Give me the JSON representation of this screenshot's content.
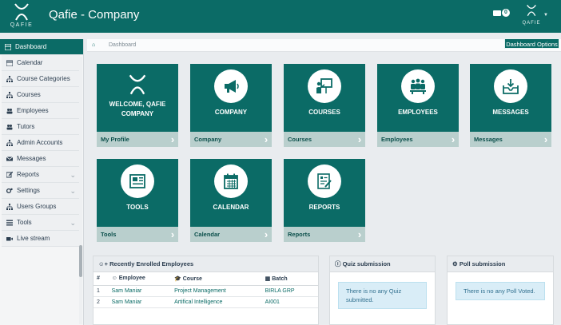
{
  "header": {
    "logo_text": "QAFIE",
    "title": "Qafie - Company",
    "mail_count": "0",
    "user_logo_text": "QAFIE"
  },
  "sidebar": {
    "items": [
      {
        "label": "Dashboard",
        "icon": "dashboard-icon",
        "active": true
      },
      {
        "label": "Calendar",
        "icon": "calendar-icon"
      },
      {
        "label": "Course Categories",
        "icon": "sitemap-icon"
      },
      {
        "label": "Courses",
        "icon": "sitemap-icon"
      },
      {
        "label": "Employees",
        "icon": "users-icon"
      },
      {
        "label": "Tutors",
        "icon": "users-icon"
      },
      {
        "label": "Admin Accounts",
        "icon": "sitemap-icon"
      },
      {
        "label": "Messages",
        "icon": "envelope-icon"
      },
      {
        "label": "Reports",
        "icon": "edit-icon",
        "expandable": true
      },
      {
        "label": "Settings",
        "icon": "cogs-icon",
        "expandable": true
      },
      {
        "label": "Users Groups",
        "icon": "sitemap-icon"
      },
      {
        "label": "Tools",
        "icon": "list-icon",
        "expandable": true
      },
      {
        "label": "Live stream",
        "icon": "video-icon"
      }
    ]
  },
  "breadcrumb": {
    "current": "Dashboard"
  },
  "dashboard_options_label": "Dashboard Options",
  "tiles": [
    {
      "title_line1": "WELCOME, QAFIE",
      "title_line2": "COMPANY",
      "footer": "My Profile",
      "icon": "qafie-logo-icon"
    },
    {
      "title_line1": "COMPANY",
      "title_line2": "",
      "footer": "Company",
      "icon": "megaphone-icon"
    },
    {
      "title_line1": "COURSES",
      "title_line2": "",
      "footer": "Courses",
      "icon": "presentation-icon"
    },
    {
      "title_line1": "EMPLOYEES",
      "title_line2": "",
      "footer": "Employees",
      "icon": "team-icon"
    },
    {
      "title_line1": "MESSAGES",
      "title_line2": "",
      "footer": "Messages",
      "icon": "inbox-icon"
    },
    {
      "title_line1": "TOOLS",
      "title_line2": "",
      "footer": "Tools",
      "icon": "newspaper-icon"
    },
    {
      "title_line1": "CALENDAR",
      "title_line2": "",
      "footer": "Calendar",
      "icon": "calendar-icon"
    },
    {
      "title_line1": "REPORTS",
      "title_line2": "",
      "footer": "Reports",
      "icon": "report-icon"
    }
  ],
  "enrolled": {
    "title": "Recently Enrolled Employees",
    "columns": [
      "#",
      "Employee",
      "Course",
      "Batch"
    ],
    "rows": [
      {
        "num": "1",
        "employee": "Sam Maniar",
        "course": "Project Management",
        "batch": "BIRLA GRP"
      },
      {
        "num": "2",
        "employee": "Sam Maniar",
        "course": "Artifical Intelligence",
        "batch": "AI001"
      }
    ]
  },
  "quiz": {
    "title": "Quiz submission",
    "message": "There is no any Quiz submitted."
  },
  "poll": {
    "title": "Poll submission",
    "message": "There is no any Poll Voted."
  },
  "colors": {
    "primary": "#0b6b66",
    "tile_footer": "#b9cfcd",
    "info_bg": "#d9edf7"
  }
}
